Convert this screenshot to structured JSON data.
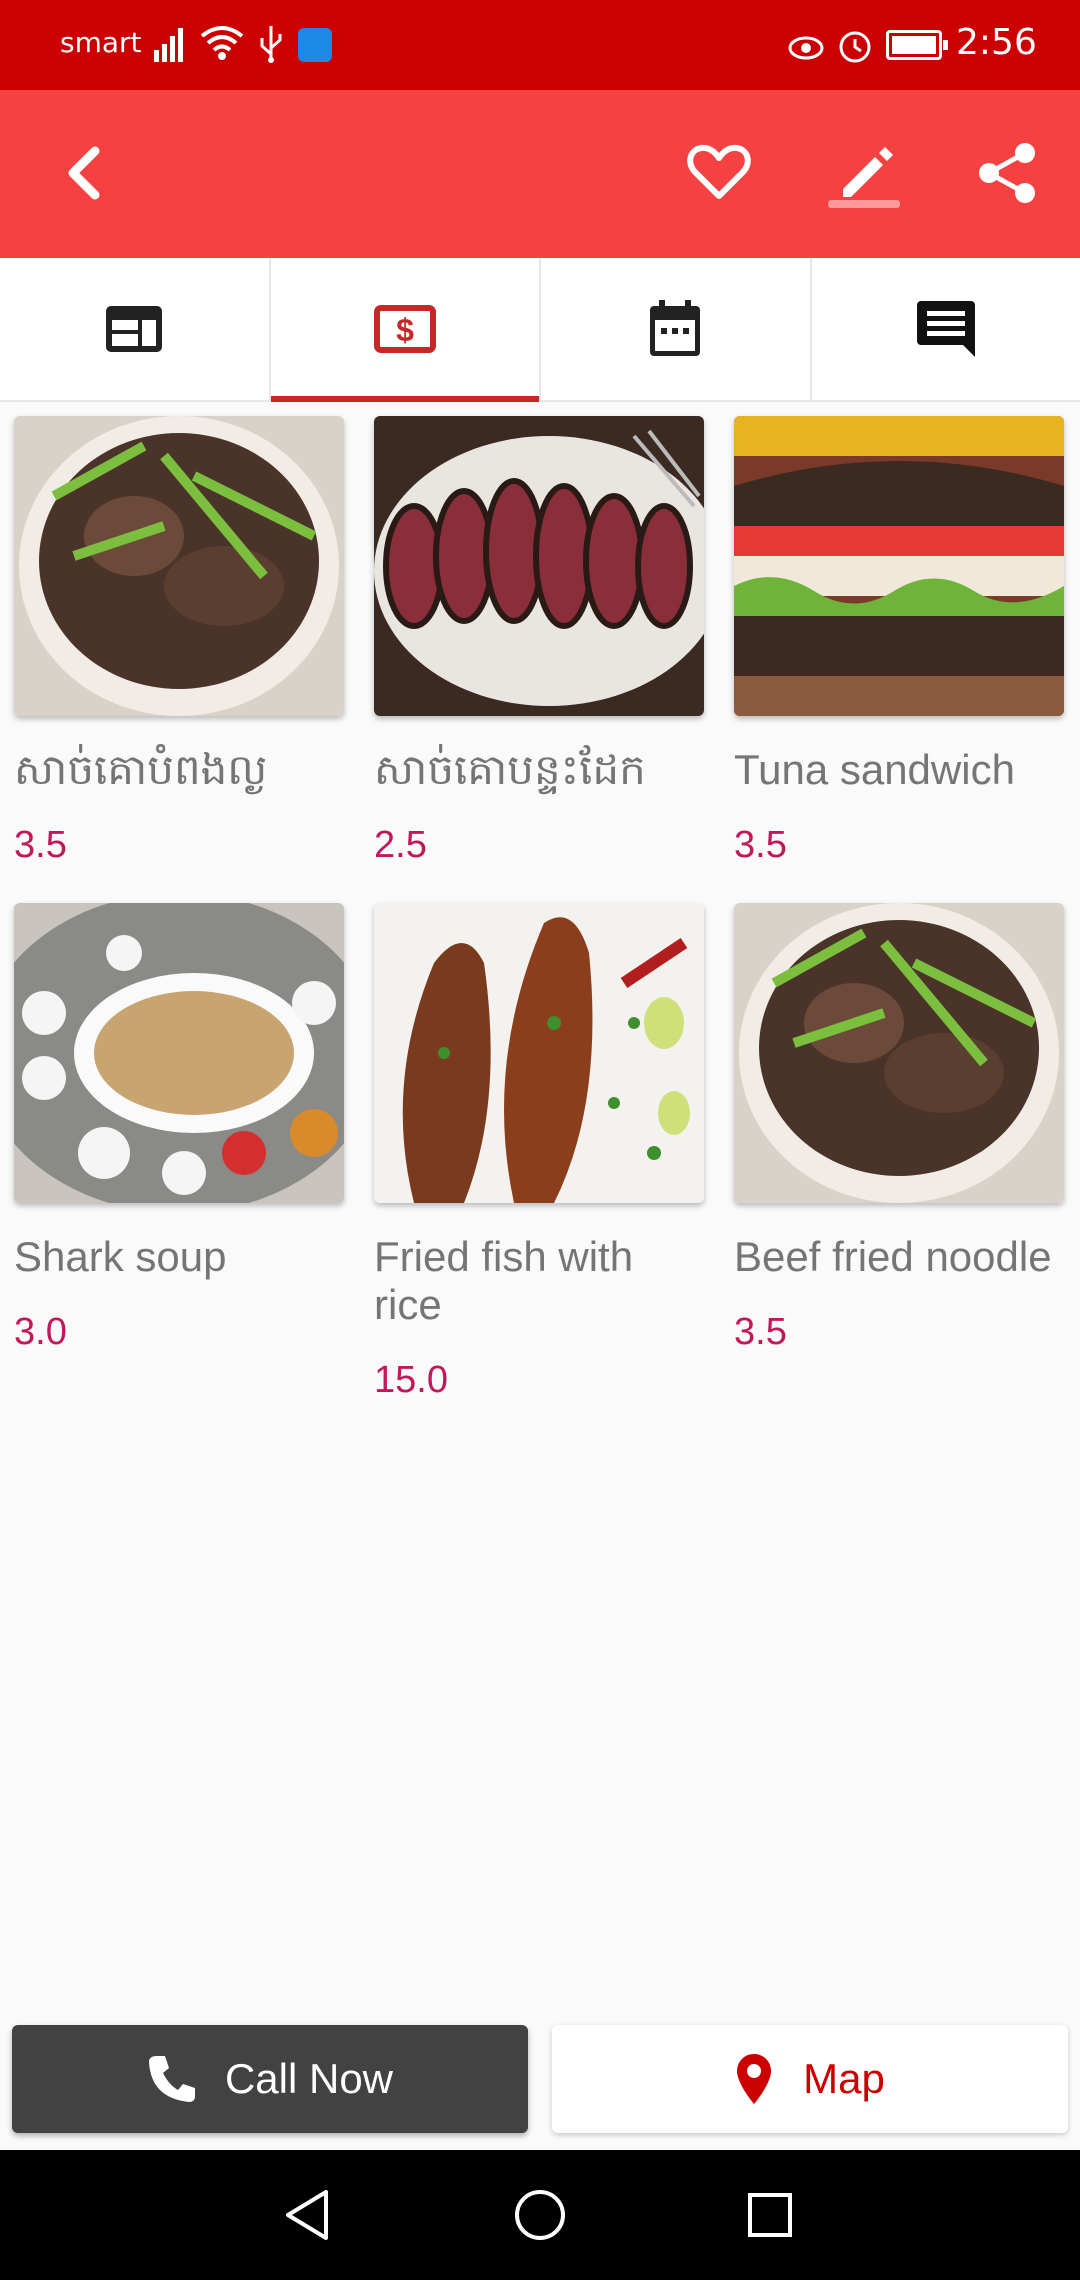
{
  "status_bar": {
    "carrier": "smart",
    "time": "2:56"
  },
  "app_bar": {
    "back_icon": "arrow-back-icon",
    "favorite_icon": "heart-outline-icon",
    "edit_icon": "pencil-icon",
    "share_icon": "share-icon"
  },
  "tabs": [
    {
      "icon": "web-info-icon",
      "active": false
    },
    {
      "icon": "dollar-icon",
      "active": true
    },
    {
      "icon": "calendar-icon",
      "active": false
    },
    {
      "icon": "comment-icon",
      "active": false
    }
  ],
  "menu": {
    "items": [
      {
        "name": "សាច់គោបំពងល្ង",
        "price": "3.5"
      },
      {
        "name": "សាច់គោបន្ទះដែក",
        "price": "2.5"
      },
      {
        "name": "Tuna sandwich",
        "price": "3.5"
      },
      {
        "name": "Shark soup",
        "price": "3.0"
      },
      {
        "name": "Fried fish with rice",
        "price": "15.0"
      },
      {
        "name": "Beef fried noodle",
        "price": "3.5"
      }
    ]
  },
  "actions": {
    "call_label": "Call Now",
    "map_label": "Map"
  },
  "colors": {
    "status_bar": "#cc0000",
    "app_bar": "#f54141",
    "accent": "#c62828",
    "price": "#c2185b"
  }
}
